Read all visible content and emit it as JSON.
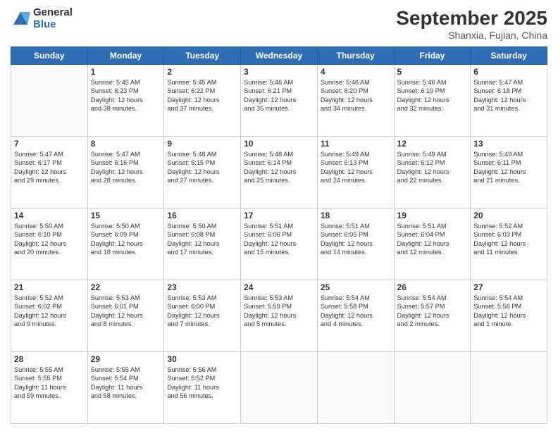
{
  "header": {
    "logo_line1": "General",
    "logo_line2": "Blue",
    "month": "September 2025",
    "location": "Shanxia, Fujian, China"
  },
  "weekdays": [
    "Sunday",
    "Monday",
    "Tuesday",
    "Wednesday",
    "Thursday",
    "Friday",
    "Saturday"
  ],
  "weeks": [
    [
      {
        "day": "",
        "info": ""
      },
      {
        "day": "1",
        "info": "Sunrise: 5:45 AM\nSunset: 6:23 PM\nDaylight: 12 hours\nand 38 minutes."
      },
      {
        "day": "2",
        "info": "Sunrise: 5:45 AM\nSunset: 6:22 PM\nDaylight: 12 hours\nand 37 minutes."
      },
      {
        "day": "3",
        "info": "Sunrise: 5:46 AM\nSunset: 6:21 PM\nDaylight: 12 hours\nand 35 minutes."
      },
      {
        "day": "4",
        "info": "Sunrise: 5:46 AM\nSunset: 6:20 PM\nDaylight: 12 hours\nand 34 minutes."
      },
      {
        "day": "5",
        "info": "Sunrise: 5:46 AM\nSunset: 6:19 PM\nDaylight: 12 hours\nand 32 minutes."
      },
      {
        "day": "6",
        "info": "Sunrise: 5:47 AM\nSunset: 6:18 PM\nDaylight: 12 hours\nand 31 minutes."
      }
    ],
    [
      {
        "day": "7",
        "info": "Sunrise: 5:47 AM\nSunset: 6:17 PM\nDaylight: 12 hours\nand 29 minutes."
      },
      {
        "day": "8",
        "info": "Sunrise: 5:47 AM\nSunset: 6:16 PM\nDaylight: 12 hours\nand 28 minutes."
      },
      {
        "day": "9",
        "info": "Sunrise: 5:48 AM\nSunset: 6:15 PM\nDaylight: 12 hours\nand 27 minutes."
      },
      {
        "day": "10",
        "info": "Sunrise: 5:48 AM\nSunset: 6:14 PM\nDaylight: 12 hours\nand 25 minutes."
      },
      {
        "day": "11",
        "info": "Sunrise: 5:49 AM\nSunset: 6:13 PM\nDaylight: 12 hours\nand 24 minutes."
      },
      {
        "day": "12",
        "info": "Sunrise: 5:49 AM\nSunset: 6:12 PM\nDaylight: 12 hours\nand 22 minutes."
      },
      {
        "day": "13",
        "info": "Sunrise: 5:49 AM\nSunset: 6:11 PM\nDaylight: 12 hours\nand 21 minutes."
      }
    ],
    [
      {
        "day": "14",
        "info": "Sunrise: 5:50 AM\nSunset: 6:10 PM\nDaylight: 12 hours\nand 20 minutes."
      },
      {
        "day": "15",
        "info": "Sunrise: 5:50 AM\nSunset: 6:09 PM\nDaylight: 12 hours\nand 18 minutes."
      },
      {
        "day": "16",
        "info": "Sunrise: 5:50 AM\nSunset: 6:08 PM\nDaylight: 12 hours\nand 17 minutes."
      },
      {
        "day": "17",
        "info": "Sunrise: 5:51 AM\nSunset: 6:06 PM\nDaylight: 12 hours\nand 15 minutes."
      },
      {
        "day": "18",
        "info": "Sunrise: 5:51 AM\nSunset: 6:05 PM\nDaylight: 12 hours\nand 14 minutes."
      },
      {
        "day": "19",
        "info": "Sunrise: 5:51 AM\nSunset: 6:04 PM\nDaylight: 12 hours\nand 12 minutes."
      },
      {
        "day": "20",
        "info": "Sunrise: 5:52 AM\nSunset: 6:03 PM\nDaylight: 12 hours\nand 11 minutes."
      }
    ],
    [
      {
        "day": "21",
        "info": "Sunrise: 5:52 AM\nSunset: 6:02 PM\nDaylight: 12 hours\nand 9 minutes."
      },
      {
        "day": "22",
        "info": "Sunrise: 5:53 AM\nSunset: 6:01 PM\nDaylight: 12 hours\nand 8 minutes."
      },
      {
        "day": "23",
        "info": "Sunrise: 5:53 AM\nSunset: 6:00 PM\nDaylight: 12 hours\nand 7 minutes."
      },
      {
        "day": "24",
        "info": "Sunrise: 5:53 AM\nSunset: 5:59 PM\nDaylight: 12 hours\nand 5 minutes."
      },
      {
        "day": "25",
        "info": "Sunrise: 5:54 AM\nSunset: 5:58 PM\nDaylight: 12 hours\nand 4 minutes."
      },
      {
        "day": "26",
        "info": "Sunrise: 5:54 AM\nSunset: 5:57 PM\nDaylight: 12 hours\nand 2 minutes."
      },
      {
        "day": "27",
        "info": "Sunrise: 5:54 AM\nSunset: 5:56 PM\nDaylight: 12 hours\nand 1 minute."
      }
    ],
    [
      {
        "day": "28",
        "info": "Sunrise: 5:55 AM\nSunset: 5:55 PM\nDaylight: 11 hours\nand 59 minutes."
      },
      {
        "day": "29",
        "info": "Sunrise: 5:55 AM\nSunset: 5:54 PM\nDaylight: 11 hours\nand 58 minutes."
      },
      {
        "day": "30",
        "info": "Sunrise: 5:56 AM\nSunset: 5:52 PM\nDaylight: 11 hours\nand 56 minutes."
      },
      {
        "day": "",
        "info": ""
      },
      {
        "day": "",
        "info": ""
      },
      {
        "day": "",
        "info": ""
      },
      {
        "day": "",
        "info": ""
      }
    ]
  ]
}
